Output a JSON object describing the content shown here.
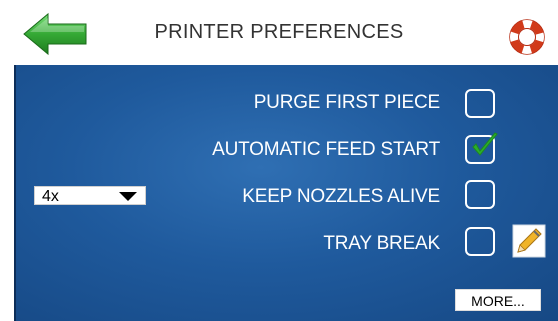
{
  "header": {
    "title": "PRINTER PREFERENCES",
    "back_icon": "back-arrow-icon",
    "help_icon": "life-ring-icon"
  },
  "options": [
    {
      "label": "PURGE FIRST PIECE",
      "checked": false
    },
    {
      "label": "AUTOMATIC FEED START",
      "checked": true
    },
    {
      "label": "KEEP NOZZLES ALIVE",
      "checked": false
    },
    {
      "label": "TRAY BREAK",
      "checked": false
    }
  ],
  "keep_alive_interval": {
    "selected": "4x"
  },
  "more_button": {
    "label": "MORE..."
  },
  "colors": {
    "panel_blue": "#1f5a9d",
    "arrow_green": "#2e9a2e",
    "check_green": "#2bb02b",
    "help_red": "#d13a1a"
  }
}
